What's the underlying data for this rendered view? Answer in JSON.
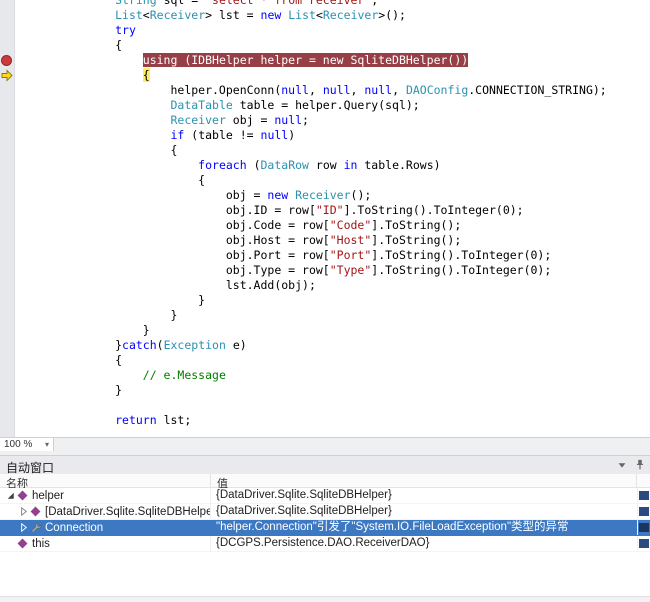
{
  "editor": {
    "zoom_label": "100 %",
    "lines": [
      {
        "segments": [
          {
            "t": "            ",
            "c": "pl"
          },
          {
            "t": "String",
            "c": "ty"
          },
          {
            "t": " sql = ",
            "c": "pl"
          },
          {
            "t": "\"select * from receiver\"",
            "c": "str"
          },
          {
            "t": ";",
            "c": "pl"
          }
        ]
      },
      {
        "segments": [
          {
            "t": "            ",
            "c": "pl"
          },
          {
            "t": "List",
            "c": "ty"
          },
          {
            "t": "<",
            "c": "pl"
          },
          {
            "t": "Receiver",
            "c": "ty"
          },
          {
            "t": "> lst = ",
            "c": "pl"
          },
          {
            "t": "new",
            "c": "kw"
          },
          {
            "t": " ",
            "c": "pl"
          },
          {
            "t": "List",
            "c": "ty"
          },
          {
            "t": "<",
            "c": "pl"
          },
          {
            "t": "Receiver",
            "c": "ty"
          },
          {
            "t": ">();",
            "c": "pl"
          }
        ]
      },
      {
        "segments": [
          {
            "t": "            ",
            "c": "pl"
          },
          {
            "t": "try",
            "c": "kw"
          }
        ]
      },
      {
        "segments": [
          {
            "t": "            {",
            "c": "pl"
          }
        ]
      },
      {
        "segments": [
          {
            "t": "                ",
            "c": "pl"
          },
          {
            "t": "using (IDBHelper helper = new SqliteDBHelper())",
            "c": "bp"
          }
        ]
      },
      {
        "segments": [
          {
            "t": "                ",
            "c": "pl"
          },
          {
            "t": "{",
            "c": "cur"
          }
        ]
      },
      {
        "segments": [
          {
            "t": "                    helper.OpenConn(",
            "c": "pl"
          },
          {
            "t": "null",
            "c": "kw"
          },
          {
            "t": ", ",
            "c": "pl"
          },
          {
            "t": "null",
            "c": "kw"
          },
          {
            "t": ", ",
            "c": "pl"
          },
          {
            "t": "null",
            "c": "kw"
          },
          {
            "t": ", ",
            "c": "pl"
          },
          {
            "t": "DAOConfig",
            "c": "ty"
          },
          {
            "t": ".CONNECTION_STRING);",
            "c": "pl"
          }
        ]
      },
      {
        "segments": [
          {
            "t": "                    ",
            "c": "pl"
          },
          {
            "t": "DataTable",
            "c": "ty"
          },
          {
            "t": " table = helper.Query(sql);",
            "c": "pl"
          }
        ]
      },
      {
        "segments": [
          {
            "t": "                    ",
            "c": "pl"
          },
          {
            "t": "Receiver",
            "c": "ty"
          },
          {
            "t": " obj = ",
            "c": "pl"
          },
          {
            "t": "null",
            "c": "kw"
          },
          {
            "t": ";",
            "c": "pl"
          }
        ]
      },
      {
        "segments": [
          {
            "t": "                    ",
            "c": "pl"
          },
          {
            "t": "if",
            "c": "kw"
          },
          {
            "t": " (table != ",
            "c": "pl"
          },
          {
            "t": "null",
            "c": "kw"
          },
          {
            "t": ")",
            "c": "pl"
          }
        ]
      },
      {
        "segments": [
          {
            "t": "                    {",
            "c": "pl"
          }
        ]
      },
      {
        "segments": [
          {
            "t": "                        ",
            "c": "pl"
          },
          {
            "t": "foreach",
            "c": "kw"
          },
          {
            "t": " (",
            "c": "pl"
          },
          {
            "t": "DataRow",
            "c": "ty"
          },
          {
            "t": " row ",
            "c": "pl"
          },
          {
            "t": "in",
            "c": "kw"
          },
          {
            "t": " table.Rows)",
            "c": "pl"
          }
        ]
      },
      {
        "segments": [
          {
            "t": "                        {",
            "c": "pl"
          }
        ]
      },
      {
        "segments": [
          {
            "t": "                            obj = ",
            "c": "pl"
          },
          {
            "t": "new",
            "c": "kw"
          },
          {
            "t": " ",
            "c": "pl"
          },
          {
            "t": "Receiver",
            "c": "ty"
          },
          {
            "t": "();",
            "c": "pl"
          }
        ]
      },
      {
        "segments": [
          {
            "t": "                            obj.ID = row[",
            "c": "pl"
          },
          {
            "t": "\"ID\"",
            "c": "str"
          },
          {
            "t": "].ToString().ToInteger(0);",
            "c": "pl"
          }
        ]
      },
      {
        "segments": [
          {
            "t": "                            obj.Code = row[",
            "c": "pl"
          },
          {
            "t": "\"Code\"",
            "c": "str"
          },
          {
            "t": "].ToString();",
            "c": "pl"
          }
        ]
      },
      {
        "segments": [
          {
            "t": "                            obj.Host = row[",
            "c": "pl"
          },
          {
            "t": "\"Host\"",
            "c": "str"
          },
          {
            "t": "].ToString();",
            "c": "pl"
          }
        ]
      },
      {
        "segments": [
          {
            "t": "                            obj.Port = row[",
            "c": "pl"
          },
          {
            "t": "\"Port\"",
            "c": "str"
          },
          {
            "t": "].ToString().ToInteger(0);",
            "c": "pl"
          }
        ]
      },
      {
        "segments": [
          {
            "t": "                            obj.Type = row[",
            "c": "pl"
          },
          {
            "t": "\"Type\"",
            "c": "str"
          },
          {
            "t": "].ToString().ToInteger(0);",
            "c": "pl"
          }
        ]
      },
      {
        "segments": [
          {
            "t": "                            lst.Add(obj);",
            "c": "pl"
          }
        ]
      },
      {
        "segments": [
          {
            "t": "                        }",
            "c": "pl"
          }
        ]
      },
      {
        "segments": [
          {
            "t": "                    }",
            "c": "pl"
          }
        ]
      },
      {
        "segments": [
          {
            "t": "                }",
            "c": "pl"
          }
        ]
      },
      {
        "segments": [
          {
            "t": "            }",
            "c": "pl"
          },
          {
            "t": "catch",
            "c": "kw"
          },
          {
            "t": "(",
            "c": "pl"
          },
          {
            "t": "Exception",
            "c": "ty"
          },
          {
            "t": " e)",
            "c": "pl"
          }
        ]
      },
      {
        "segments": [
          {
            "t": "            {",
            "c": "pl"
          }
        ]
      },
      {
        "segments": [
          {
            "t": "                ",
            "c": "pl"
          },
          {
            "t": "// e.Message",
            "c": "cm"
          }
        ]
      },
      {
        "segments": [
          {
            "t": "            }",
            "c": "pl"
          }
        ]
      },
      {
        "segments": [
          {
            "t": " ",
            "c": "pl"
          }
        ]
      },
      {
        "segments": [
          {
            "t": "            ",
            "c": "pl"
          },
          {
            "t": "return",
            "c": "kw"
          },
          {
            "t": " lst;",
            "c": "pl"
          }
        ]
      }
    ]
  },
  "autos": {
    "title": "自动窗口",
    "title_icons": [
      "chevron-down-icon",
      "pin-icon"
    ],
    "columns": {
      "name": "名称",
      "value": "值"
    },
    "rows": [
      {
        "name": "helper",
        "value": "{DataDriver.Sqlite.SqliteDBHelper}",
        "icon": "field",
        "expand": "expanded",
        "indent": 0,
        "selected": false
      },
      {
        "name": "[DataDriver.Sqlite.SqliteDBHelper]",
        "value": "{DataDriver.Sqlite.SqliteDBHelper}",
        "icon": "field",
        "expand": "collapsed",
        "indent": 1,
        "selected": false
      },
      {
        "name": "Connection",
        "value": "\"helper.Connection\"引发了\"System.IO.FileLoadException\"类型的异常",
        "icon": "property",
        "expand": "collapsed",
        "indent": 1,
        "selected": true
      },
      {
        "name": "this",
        "value": "{DCGPS.Persistence.DAO.ReceiverDAO}",
        "icon": "field",
        "expand": "none",
        "indent": 0,
        "selected": false
      }
    ],
    "colors": {
      "breakpoint_line_bg": "#963f46",
      "current_statement_bg": "#ffee62",
      "selection_bg": "#3d79c2"
    }
  }
}
